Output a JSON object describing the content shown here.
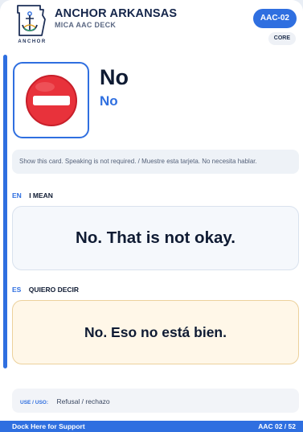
{
  "header": {
    "logo_text": "ANCHOR",
    "brand_name": "ANCHOR ARKANSAS",
    "deck_name": "MICA AAC DECK",
    "card_code": "AAC-02",
    "category": "CORE"
  },
  "card": {
    "symbol_icon": "no-entry-icon",
    "word_primary": "No",
    "word_secondary": "No",
    "instruction": "Show this card. Speaking is not required. / Muestre esta tarjeta. No necesita hablar."
  },
  "english": {
    "code": "EN",
    "title": "I MEAN",
    "phrase": "No. That is not okay."
  },
  "spanish": {
    "code": "ES",
    "title": "QUIERO DECIR",
    "phrase": "No. Eso no está bien."
  },
  "usage": {
    "label": "USE / USO:",
    "value": "Refusal / rechazo"
  },
  "footer": {
    "support_text": "Dock Here for Support",
    "page_counter": "AAC 02 / 52"
  },
  "colors": {
    "accent": "#2f6fe0",
    "stop_red": "#e8323b",
    "spanish_bg": "#fff7e8"
  }
}
